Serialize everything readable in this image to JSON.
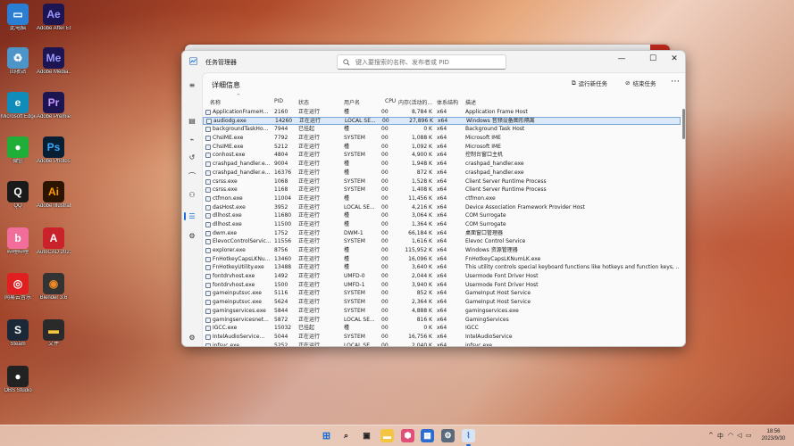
{
  "desktop": {
    "icons": [
      {
        "label": "此电脑",
        "color": "#2a7fd4",
        "glyph": "▭",
        "icon": "computer-icon"
      },
      {
        "label": "Adobe After Effects 2023",
        "color": "#1d1552",
        "glyph": "Ae",
        "icon": "after-effects-icon",
        "fg": "#9a9aff"
      },
      {
        "label": "回收站",
        "color": "#4d95c9",
        "glyph": "♻",
        "icon": "recycle-bin-icon"
      },
      {
        "label": "Adobe Media...",
        "color": "#1d1552",
        "glyph": "Me",
        "icon": "media-encoder-icon",
        "fg": "#9a9aff"
      },
      {
        "label": "Microsoft Edge",
        "color": "#0f8cba",
        "glyph": "e",
        "icon": "edge-icon"
      },
      {
        "label": "Adobe Premiere P...",
        "color": "#1d1552",
        "glyph": "Pr",
        "icon": "premiere-icon",
        "fg": "#c99aff"
      },
      {
        "label": "微信",
        "color": "#1fae37",
        "glyph": "●",
        "icon": "wechat-icon"
      },
      {
        "label": "Adobe Photosho...",
        "color": "#071e33",
        "glyph": "Ps",
        "icon": "photoshop-icon",
        "fg": "#39a8ff"
      },
      {
        "label": "QQ",
        "color": "#1a1a1a",
        "glyph": "Q",
        "icon": "qq-icon"
      },
      {
        "label": "Adobe Illustrat...",
        "color": "#2b1400",
        "glyph": "Ai",
        "icon": "illustrator-icon",
        "fg": "#ff9a00"
      },
      {
        "label": "哔哩哔哩",
        "color": "#f26e9a",
        "glyph": "b",
        "icon": "bilibili-icon"
      },
      {
        "label": "AutoCAD 2023",
        "color": "#c9222b",
        "glyph": "A",
        "icon": "autocad-icon"
      },
      {
        "label": "网易云音乐",
        "color": "#e02020",
        "glyph": "◎",
        "icon": "netease-music-icon"
      },
      {
        "label": "Blender 3.6",
        "color": "#333333",
        "glyph": "◉",
        "icon": "blender-icon",
        "fg": "#f08a24"
      },
      {
        "label": "Steam",
        "color": "#1b2838",
        "glyph": "S",
        "icon": "steam-icon"
      },
      {
        "label": "文件",
        "color": "#2a2a2a",
        "glyph": "▬",
        "icon": "file-icon",
        "fg": "#f5c542"
      },
      {
        "label": "OBS Studio",
        "color": "#222222",
        "glyph": "●",
        "icon": "obs-icon"
      }
    ]
  },
  "window": {
    "title": "任务管理器",
    "search_placeholder": "键入要搜索的名称、发布者或 PID",
    "minimize": "—",
    "maximize": "☐",
    "close": "✕"
  },
  "page": {
    "title": "详细信息",
    "run_task": "运行新任务",
    "end_task": "结束任务",
    "more": "⋯"
  },
  "table": {
    "columns": {
      "name": "名称",
      "pid": "PID",
      "status": "状态",
      "user": "用户名",
      "cpu": "CPU",
      "memory": "内存(活动的...",
      "arch": "体系结构",
      "desc": "描述"
    },
    "rows": [
      {
        "name": "ApplicationFrameH...",
        "pid": "2160",
        "status": "正在运行",
        "user": "槿",
        "cpu": "00",
        "mem": "8,784 K",
        "arch": "x64",
        "desc": "Application Frame Host"
      },
      {
        "name": "audiodg.exe",
        "pid": "14260",
        "status": "正在运行",
        "user": "LOCAL SE...",
        "cpu": "00",
        "mem": "27,896 K",
        "arch": "x64",
        "desc": "Windows 音频设备图形隔离",
        "selected": true
      },
      {
        "name": "backgroundTaskHo...",
        "pid": "7944",
        "status": "已挂起",
        "user": "槿",
        "cpu": "00",
        "mem": "0 K",
        "arch": "x64",
        "desc": "Background Task Host"
      },
      {
        "name": "ChsIME.exe",
        "pid": "7792",
        "status": "正在运行",
        "user": "SYSTEM",
        "cpu": "00",
        "mem": "1,088 K",
        "arch": "x64",
        "desc": "Microsoft IME"
      },
      {
        "name": "ChsIME.exe",
        "pid": "5212",
        "status": "正在运行",
        "user": "槿",
        "cpu": "00",
        "mem": "1,092 K",
        "arch": "x64",
        "desc": "Microsoft IME"
      },
      {
        "name": "conhost.exe",
        "pid": "4804",
        "status": "正在运行",
        "user": "SYSTEM",
        "cpu": "00",
        "mem": "4,900 K",
        "arch": "x64",
        "desc": "控制台窗口主机"
      },
      {
        "name": "crashpad_handler.e...",
        "pid": "9004",
        "status": "正在运行",
        "user": "槿",
        "cpu": "00",
        "mem": "1,948 K",
        "arch": "x64",
        "desc": "crashpad_handler.exe"
      },
      {
        "name": "crashpad_handler.e...",
        "pid": "16376",
        "status": "正在运行",
        "user": "槿",
        "cpu": "00",
        "mem": "872 K",
        "arch": "x64",
        "desc": "crashpad_handler.exe"
      },
      {
        "name": "csrss.exe",
        "pid": "1068",
        "status": "正在运行",
        "user": "SYSTEM",
        "cpu": "00",
        "mem": "1,528 K",
        "arch": "x64",
        "desc": "Client Server Runtime Process"
      },
      {
        "name": "csrss.exe",
        "pid": "1168",
        "status": "正在运行",
        "user": "SYSTEM",
        "cpu": "00",
        "mem": "1,408 K",
        "arch": "x64",
        "desc": "Client Server Runtime Process"
      },
      {
        "name": "ctfmon.exe",
        "pid": "11004",
        "status": "正在运行",
        "user": "槿",
        "cpu": "00",
        "mem": "11,456 K",
        "arch": "x64",
        "desc": "ctfmon.exe"
      },
      {
        "name": "dasHost.exe",
        "pid": "3952",
        "status": "正在运行",
        "user": "LOCAL SE...",
        "cpu": "00",
        "mem": "4,216 K",
        "arch": "x64",
        "desc": "Device Association Framework Provider Host"
      },
      {
        "name": "dllhost.exe",
        "pid": "11680",
        "status": "正在运行",
        "user": "槿",
        "cpu": "00",
        "mem": "3,064 K",
        "arch": "x64",
        "desc": "COM Surrogate"
      },
      {
        "name": "dllhost.exe",
        "pid": "11500",
        "status": "正在运行",
        "user": "槿",
        "cpu": "00",
        "mem": "1,364 K",
        "arch": "x64",
        "desc": "COM Surrogate"
      },
      {
        "name": "dwm.exe",
        "pid": "1752",
        "status": "正在运行",
        "user": "DWM-1",
        "cpu": "00",
        "mem": "66,184 K",
        "arch": "x64",
        "desc": "桌面窗口管理器"
      },
      {
        "name": "ElevocControlServic...",
        "pid": "11556",
        "status": "正在运行",
        "user": "SYSTEM",
        "cpu": "00",
        "mem": "1,616 K",
        "arch": "x64",
        "desc": "Elevoc Control Service"
      },
      {
        "name": "explorer.exe",
        "pid": "8756",
        "status": "正在运行",
        "user": "槿",
        "cpu": "00",
        "mem": "115,952 K",
        "arch": "x64",
        "desc": "Windows 资源管理器"
      },
      {
        "name": "FnHotkeyCapsLKNu...",
        "pid": "13460",
        "status": "正在运行",
        "user": "槿",
        "cpu": "00",
        "mem": "16,096 K",
        "arch": "x64",
        "desc": "FnHotkeyCapsLKNumLK.exe"
      },
      {
        "name": "FnHotkeyUtility.exe",
        "pid": "13488",
        "status": "正在运行",
        "user": "槿",
        "cpu": "00",
        "mem": "3,640 K",
        "arch": "x64",
        "desc": "This utility controls special keyboard functions like hotkeys and function keys, ..."
      },
      {
        "name": "fontdrvhost.exe",
        "pid": "1492",
        "status": "正在运行",
        "user": "UMFD-0",
        "cpu": "00",
        "mem": "2,044 K",
        "arch": "x64",
        "desc": "Usermode Font Driver Host"
      },
      {
        "name": "fontdrvhost.exe",
        "pid": "1500",
        "status": "正在运行",
        "user": "UMFD-1",
        "cpu": "00",
        "mem": "3,940 K",
        "arch": "x64",
        "desc": "Usermode Font Driver Host"
      },
      {
        "name": "gameinputsvc.exe",
        "pid": "5116",
        "status": "正在运行",
        "user": "SYSTEM",
        "cpu": "00",
        "mem": "852 K",
        "arch": "x64",
        "desc": "GameInput Host Service"
      },
      {
        "name": "gameinputsvc.exe",
        "pid": "5624",
        "status": "正在运行",
        "user": "SYSTEM",
        "cpu": "00",
        "mem": "2,364 K",
        "arch": "x64",
        "desc": "GameInput Host Service"
      },
      {
        "name": "gamingservices.exe",
        "pid": "5844",
        "status": "正在运行",
        "user": "SYSTEM",
        "cpu": "00",
        "mem": "4,888 K",
        "arch": "x64",
        "desc": "gamingservices.exe"
      },
      {
        "name": "gamingservicesnet...",
        "pid": "5872",
        "status": "正在运行",
        "user": "LOCAL SE...",
        "cpu": "00",
        "mem": "816 K",
        "arch": "x64",
        "desc": "GamingServices"
      },
      {
        "name": "IGCC.exe",
        "pid": "15032",
        "status": "已挂起",
        "user": "槿",
        "cpu": "00",
        "mem": "0 K",
        "arch": "x64",
        "desc": "IGCC"
      },
      {
        "name": "IntelAudioService...",
        "pid": "5044",
        "status": "正在运行",
        "user": "SYSTEM",
        "cpu": "00",
        "mem": "16,756 K",
        "arch": "x64",
        "desc": "IntelAudioService"
      },
      {
        "name": "ipfsvc.exe",
        "pid": "5252",
        "status": "正在运行",
        "user": "LOCAL SE...",
        "cpu": "00",
        "mem": "2,040 K",
        "arch": "x64",
        "desc": "ipfsvc.exe"
      }
    ]
  },
  "taskbar": {
    "tray_chevron": "^",
    "tray_input_lang": "中",
    "tray_wifi": "◠",
    "tray_volume": "◁",
    "tray_battery": "▭",
    "time": "18:56",
    "date": "2023/9/30"
  },
  "colors": {
    "accent": "#1a6dd9",
    "selected_row": "#dbe8f7"
  }
}
